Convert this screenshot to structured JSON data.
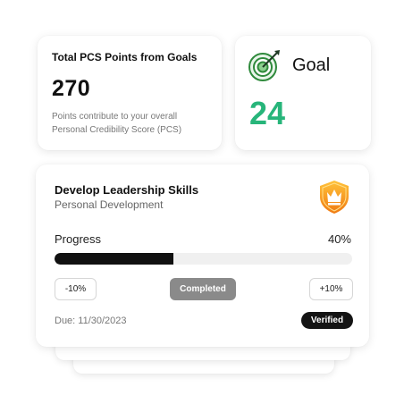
{
  "pcs": {
    "title": "Total PCS Points from Goals",
    "value": "270",
    "description": "Points contribute to your overall Personal Credibility Score (PCS)"
  },
  "goal": {
    "icon": "target-icon",
    "label": "Goal",
    "value": "24",
    "accent": "#27b57a"
  },
  "task": {
    "title": "Develop Leadership Skills",
    "category": "Personal Development",
    "badge_icon": "crown-shield-icon",
    "progress_label": "Progress",
    "progress_text": "40%",
    "progress_fraction": 0.4,
    "minus_label": "-10%",
    "completed_label": "Completed",
    "plus_label": "+10%",
    "due": "Due: 11/30/2023",
    "verified_label": "Verified"
  }
}
